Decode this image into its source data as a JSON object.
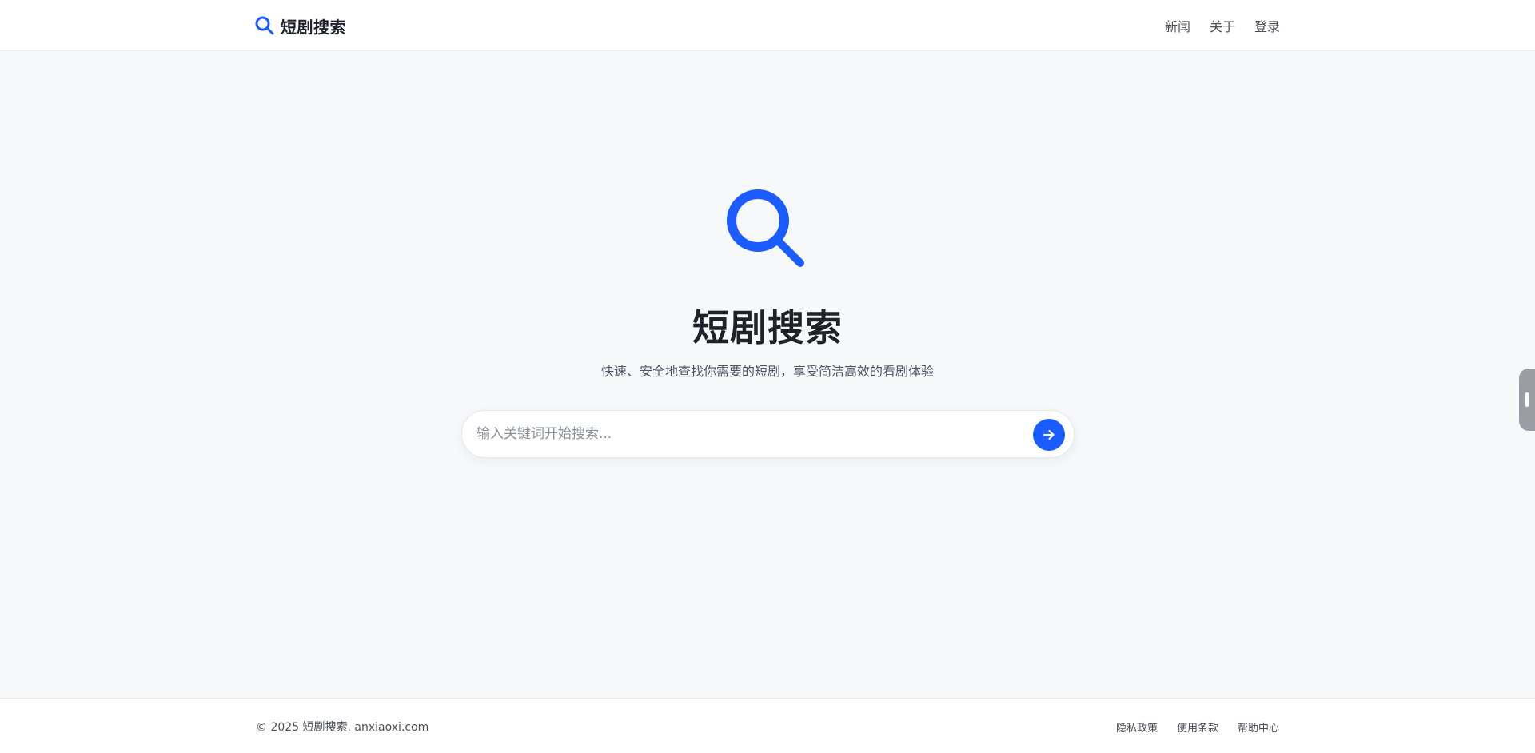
{
  "header": {
    "brand_icon": "search-icon",
    "brand_name": "短剧搜索",
    "nav": [
      {
        "label": "新闻"
      },
      {
        "label": "关于"
      },
      {
        "label": "登录"
      }
    ]
  },
  "hero": {
    "icon": "search-icon",
    "title": "短剧搜索",
    "subtitle": "快速、安全地查找你需要的短剧，享受简洁高效的看剧体验"
  },
  "search": {
    "placeholder": "输入关键词开始搜索...",
    "value": "",
    "button_icon": "arrow-right-icon"
  },
  "footer": {
    "copyright": "© 2025 短剧搜索. anxiaoxi.com",
    "links": [
      {
        "label": "隐私政策"
      },
      {
        "label": "使用条款"
      },
      {
        "label": "帮助中心"
      }
    ]
  },
  "colors": {
    "accent": "#1a5cff",
    "page_background": "#f7f8fa",
    "text_primary": "#1f2329",
    "text_secondary": "#4f5560"
  }
}
